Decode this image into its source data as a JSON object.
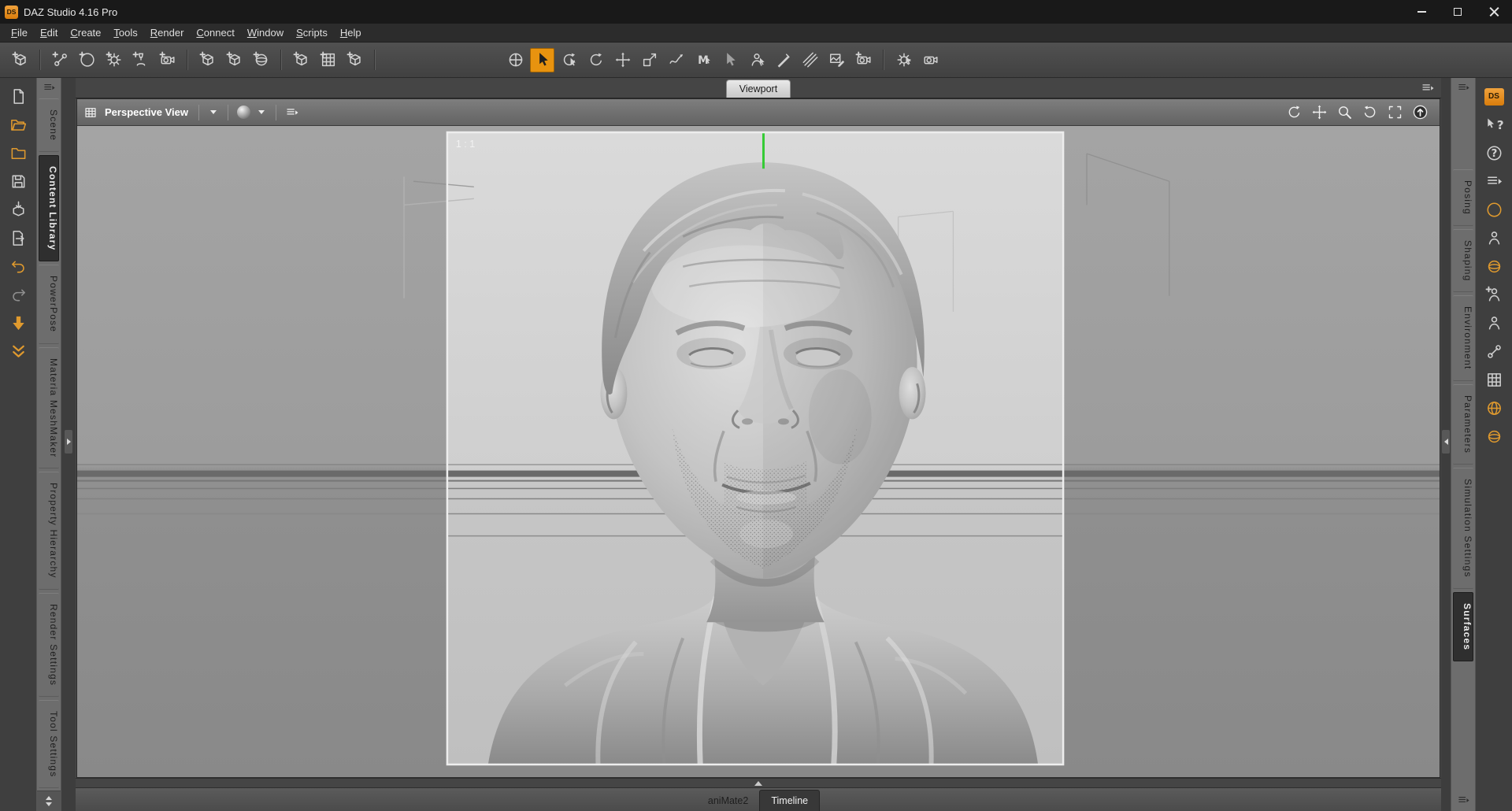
{
  "titlebar": {
    "title": "DAZ Studio 4.16 Pro",
    "logo_text": "DS"
  },
  "menu": {
    "items": [
      "File",
      "Edit",
      "Create",
      "Tools",
      "Render",
      "Connect",
      "Window",
      "Scripts",
      "Help"
    ]
  },
  "toolbar": {
    "active_tool": "node-selection-tool",
    "create_tools": [
      "create-new-node",
      "create-new-bone",
      "create-new-null",
      "create-new-gear",
      "create-new-spotlight",
      "create-new-camera",
      "create-new-cube",
      "create-new-group",
      "create-new-primitive",
      "create-new-instance",
      "create-instance-group",
      "duplicate-node"
    ],
    "selection_tools": [
      "universal-manipulator-tool",
      "node-selection-tool",
      "scene-navigator-tool",
      "rotate-tool",
      "translate-tool",
      "scale-tool",
      "dforce-brush-tool",
      "geometry-editor-tool",
      "polygon-group-editor-tool",
      "figure-selection-tool",
      "geometry-cutout-tool",
      "weight-map-brush-tool",
      "region-navigator-tool",
      "spot-render-tool",
      "tool-options",
      "render-camera"
    ]
  },
  "left_rail": {
    "icons": [
      "new-file",
      "open-file",
      "merge-file",
      "save-file",
      "import-file",
      "export-file",
      "undo",
      "redo",
      "download-queue",
      "install-content"
    ]
  },
  "right_rail": {
    "icons": [
      "daz-store",
      "whats-this",
      "help",
      "lessons-pane",
      "info-pane",
      "pose-presets",
      "material-ball",
      "figure-pose",
      "figure-shaping",
      "figure-armature",
      "mesh-grid",
      "environment",
      "surfaces-ball"
    ]
  },
  "left_tabs": {
    "active": "Content Library",
    "items": [
      "Scene",
      "Content Library",
      "PowerPose",
      "Materia MeshMaker",
      "Property Hierarchy",
      "Render Settings",
      "Tool Settings"
    ]
  },
  "right_tabs": {
    "active": "Surfaces",
    "items": [
      "Posing",
      "Shaping",
      "Environment",
      "Parameters",
      "Simulation Settings",
      "Surfaces"
    ]
  },
  "viewport": {
    "tab": "Viewport",
    "camera_selector": "Perspective View",
    "aspect_label": "1 : 1"
  },
  "bottom_tabs": {
    "active": "Timeline",
    "items": [
      "aniMate2",
      "Timeline"
    ]
  },
  "colors": {
    "accent_orange": "#e8930f",
    "axis_green": "#35cb35",
    "chrome": "#4a4a4a",
    "viewport_bg": "#9a9a9a",
    "frame_bg": "#d2d2d2",
    "active_tab_bg": "#303030"
  }
}
